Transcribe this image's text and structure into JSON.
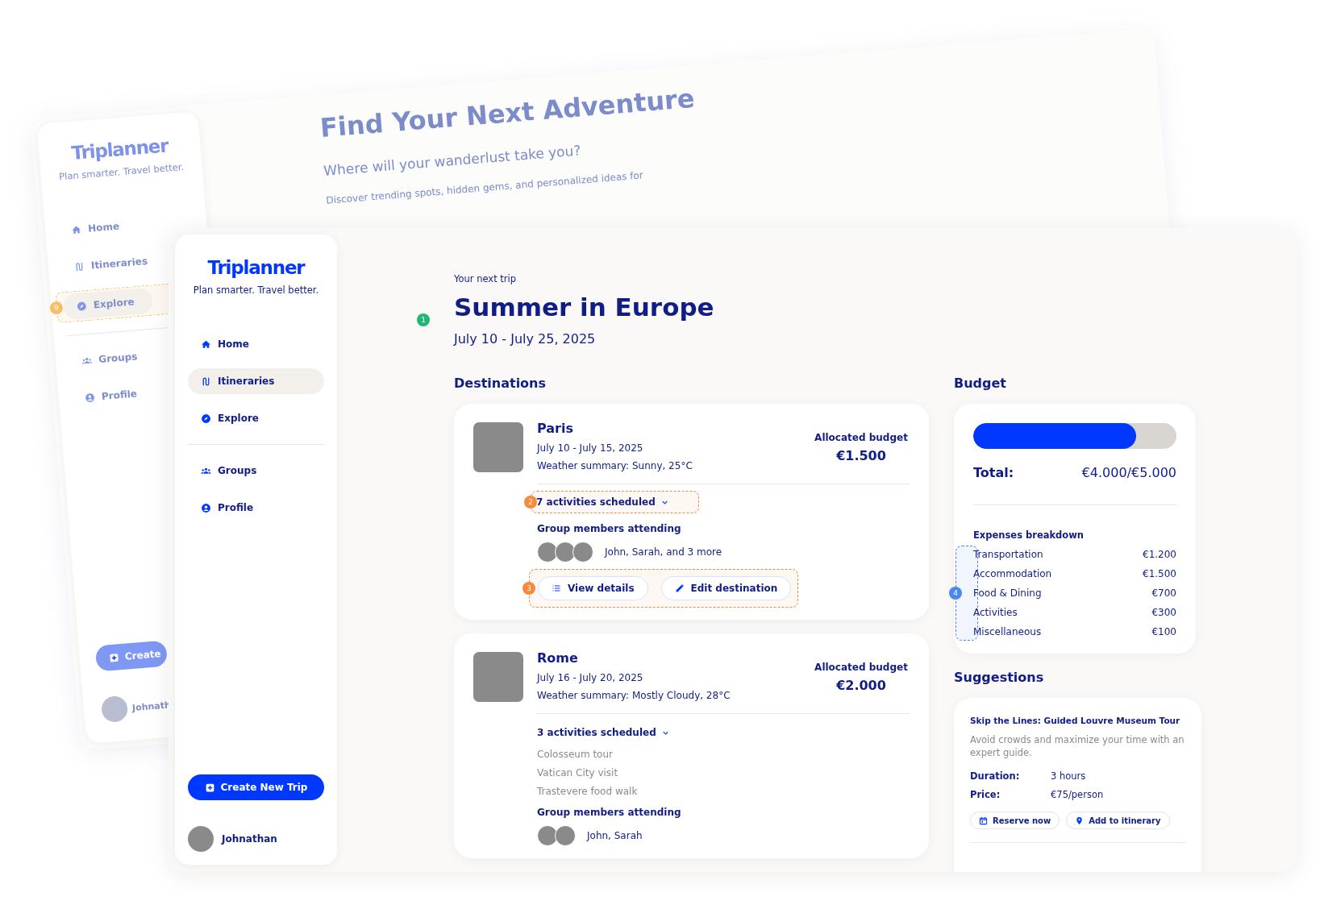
{
  "background_window": {
    "sidebar": {
      "logo": "Triplanner",
      "tagline": "Plan smarter. Travel better.",
      "sections": [
        {
          "items": [
            {
              "label": "Home",
              "kind": "home",
              "selected": false
            },
            {
              "label": "Itineraries",
              "kind": "route",
              "selected": false
            },
            {
              "label": "Explore",
              "kind": "compass",
              "selected": true,
              "annotation": {
                "number": "9",
                "color": "#f7c067"
              }
            }
          ]
        },
        {
          "items": [
            {
              "label": "Groups",
              "kind": "groups",
              "selected": false
            },
            {
              "label": "Profile",
              "kind": "profile",
              "selected": false
            }
          ]
        }
      ],
      "create_button": "Create",
      "user": "Johnath"
    },
    "main": {
      "title": "Find Your Next Adventure",
      "subtitle": "Where will your wanderlust take you?",
      "description": "Discover trending spots, hidden gems, and personalized ideas for"
    }
  },
  "sidebar": {
    "logo": "Triplanner",
    "tagline": "Plan smarter. Travel better.",
    "sections": [
      {
        "items": [
          {
            "label": "Home",
            "kind": "home",
            "selected": false
          },
          {
            "label": "Itineraries",
            "kind": "route",
            "selected": true
          },
          {
            "label": "Explore",
            "kind": "compass",
            "selected": false
          }
        ]
      },
      {
        "items": [
          {
            "label": "Groups",
            "kind": "groups",
            "selected": false
          },
          {
            "label": "Profile",
            "kind": "profile",
            "selected": false
          }
        ]
      }
    ],
    "create_button": "Create New Trip",
    "user": "Johnathan"
  },
  "trip": {
    "eyebrow": "Your next trip",
    "title": "Summer in Europe",
    "dates": "July 10 - July 25, 2025",
    "annotation": {
      "number": "1",
      "color": "#22b573"
    }
  },
  "destinations": {
    "heading": "Destinations",
    "items": [
      {
        "name": "Paris",
        "dates": "July 10 - July 15, 2025",
        "weather": "Weather summary: Sunny, 25°C",
        "budget_label": "Allocated budget",
        "budget_amount": "€1.500",
        "activities": {
          "label": "7 activities scheduled",
          "annotation": {
            "number": "2",
            "color": "#f58a3c"
          }
        },
        "members_label": "Group members attending",
        "avatars": [
          {
            "kind": "avatar"
          },
          {
            "kind": "avatar"
          },
          {
            "kind": "avatar"
          }
        ],
        "members": "John, Sarah, and 3 more",
        "actions": {
          "annotation": {
            "number": "3",
            "color": "#f58a3c"
          },
          "buttons": [
            {
              "label": "View details",
              "kind": "list"
            },
            {
              "label": "Edit destination",
              "kind": "edit"
            }
          ]
        }
      },
      {
        "name": "Rome",
        "dates": "July 16 - July 20, 2025",
        "weather": "Weather summary: Mostly Cloudy, 28°C",
        "budget_label": "Allocated budget",
        "budget_amount": "€2.000",
        "activities": {
          "label": "3 activities scheduled",
          "items": [
            "Colosseum tour",
            "Vatican City visit",
            "Trastevere food walk"
          ]
        },
        "members_label": "Group members attending",
        "avatars": [
          {
            "kind": "avatar"
          },
          {
            "kind": "avatar"
          }
        ],
        "members": "John, Sarah"
      }
    ]
  },
  "budget": {
    "heading": "Budget",
    "level": 0.8,
    "total_label": "Total:",
    "total_value": "€4.000/€5.000",
    "breakdown_heading": "Expenses breakdown",
    "annotation": {
      "number": "4",
      "color": "#4a86f5"
    },
    "expenses": [
      {
        "label": "Transportation",
        "amount": "€1.200"
      },
      {
        "label": "Accommodation",
        "amount": "€1.500"
      },
      {
        "label": "Food & Dining",
        "amount": "€700"
      },
      {
        "label": "Activities",
        "amount": "€300"
      },
      {
        "label": "Miscellaneous",
        "amount": "€100"
      }
    ]
  },
  "suggestions": {
    "heading": "Suggestions",
    "items": [
      {
        "title": "Skip the Lines: Guided Louvre Museum Tour",
        "description": "Avoid crowds and maximize your time with an expert guide.",
        "details": [
          {
            "label": "Duration:",
            "value": "3 hours"
          },
          {
            "label": "Price:",
            "value": "€75/person"
          }
        ],
        "actions": [
          {
            "label": "Reserve now",
            "kind": "calendar"
          },
          {
            "label": "Add to itinerary",
            "kind": "pin"
          }
        ]
      }
    ]
  }
}
